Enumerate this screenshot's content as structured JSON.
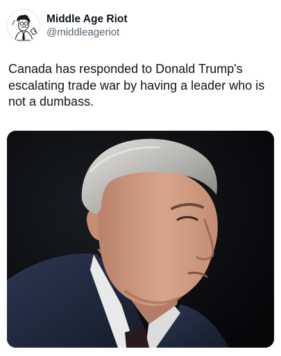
{
  "tweet": {
    "author": {
      "display_name": "Middle Age Riot",
      "handle": "@middleageriot",
      "avatar_icon": "cartoon-man-avatar-icon"
    },
    "text": "Canada has responded to Donald Trump's escalating trade war by having a leader who is not a dumbass.",
    "media": {
      "type": "photo",
      "background_color": "#07080b"
    }
  },
  "colors": {
    "text_primary": "#0f1419",
    "text_secondary": "#536471",
    "background": "#ffffff"
  }
}
